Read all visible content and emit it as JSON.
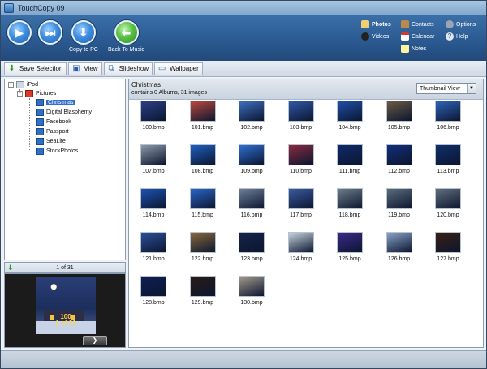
{
  "window": {
    "title": "TouchCopy 09"
  },
  "header": {
    "buttons": [
      {
        "name": "play",
        "label": "",
        "glyph": "▶"
      },
      {
        "name": "next",
        "label": "",
        "glyph": "⏭"
      },
      {
        "name": "copy-to-pc",
        "label": "Copy to PC",
        "glyph": "⬇"
      },
      {
        "name": "back-to-music",
        "label": "Back To Music",
        "glyph": "⬅"
      }
    ],
    "menu": {
      "photos": "Photos",
      "videos": "Videos",
      "contacts": "Contacts",
      "calendar": "Calendar",
      "notes": "Notes",
      "options": "Options",
      "help": "Help"
    }
  },
  "toolbar": {
    "save_selection": "Save Selection",
    "view": "View",
    "slideshow": "Slideshow",
    "wallpaper": "Wallpaper"
  },
  "tree": {
    "root": "iPod",
    "pictures": "Pictures",
    "items": [
      "Christmas",
      "Digital Blasphemy",
      "Facebook",
      "Passport",
      "SeaLife",
      "StockPhotos"
    ],
    "selected_index": 0
  },
  "preview": {
    "counter": "1 of 31",
    "caption_line1": "100",
    "caption_line2": "1 of 31",
    "next_glyph": "❯"
  },
  "gallery": {
    "folder_title": "Christmas",
    "info": "contains 0 Albums, 31 images",
    "view_mode": "Thumbnail View",
    "items": [
      {
        "name": "100.bmp",
        "color": "#2c3f86"
      },
      {
        "name": "101.bmp",
        "color": "#b84a3c"
      },
      {
        "name": "102.bmp",
        "color": "#3d6fbf"
      },
      {
        "name": "103.bmp",
        "color": "#2f58a8"
      },
      {
        "name": "104.bmp",
        "color": "#1f4fa8"
      },
      {
        "name": "105.bmp",
        "color": "#6b5a44"
      },
      {
        "name": "106.bmp",
        "color": "#2e63b8"
      },
      {
        "name": "107.bmp",
        "color": "#8d98a7"
      },
      {
        "name": "108.bmp",
        "color": "#1f5fc0"
      },
      {
        "name": "109.bmp",
        "color": "#2e6fd0"
      },
      {
        "name": "110.bmp",
        "color": "#8a2a3f"
      },
      {
        "name": "111.bmp",
        "color": "#0f2a6a"
      },
      {
        "name": "112.bmp",
        "color": "#122f7a"
      },
      {
        "name": "113.bmp",
        "color": "#0f2f6a"
      },
      {
        "name": "114.bmp",
        "color": "#1c53b0"
      },
      {
        "name": "115.bmp",
        "color": "#2a66c8"
      },
      {
        "name": "116.bmp",
        "color": "#6e7f99"
      },
      {
        "name": "117.bmp",
        "color": "#3a5aa0"
      },
      {
        "name": "118.bmp",
        "color": "#6c7d89"
      },
      {
        "name": "119.bmp",
        "color": "#5a6d7c"
      },
      {
        "name": "120.bmp",
        "color": "#5f6f7c"
      },
      {
        "name": "121.bmp",
        "color": "#2c4f9a"
      },
      {
        "name": "122.bmp",
        "color": "#8a6a3a"
      },
      {
        "name": "123.bmp",
        "color": "#16234a"
      },
      {
        "name": "124.bmp",
        "color": "#c7d2de"
      },
      {
        "name": "125.bmp",
        "color": "#3b2a8a"
      },
      {
        "name": "126.bmp",
        "color": "#8aa3c8"
      },
      {
        "name": "127.bmp",
        "color": "#3a1f12"
      },
      {
        "name": "128.bmp",
        "color": "#0e1f55"
      },
      {
        "name": "129.bmp",
        "color": "#2a1a14"
      },
      {
        "name": "130.bmp",
        "color": "#a49a8a"
      }
    ]
  },
  "colors": {
    "header": "#2b5a92",
    "selection": "#3170c8",
    "preview_text": "#ffd640"
  }
}
